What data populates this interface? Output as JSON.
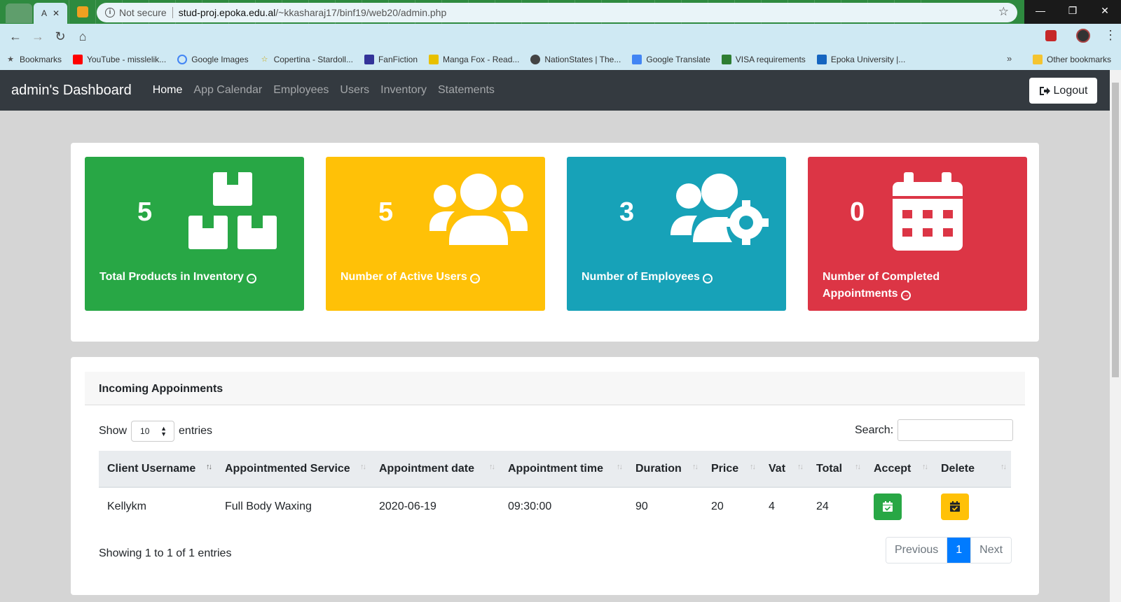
{
  "browser": {
    "active_tab_label": "A",
    "new_tab": "+",
    "window_controls": {
      "minimize": "—",
      "restore": "❐",
      "close": "✕"
    },
    "omnibox": {
      "security": "Not secure",
      "host": "stud-proj.epoka.edu.al",
      "path": "/~kkasharaj17/binf19/web20/admin.php"
    },
    "bookmarks": [
      {
        "label": "Bookmarks",
        "icon": "star-icon",
        "color": "#555555"
      },
      {
        "label": "YouTube - misslelik...",
        "icon": "youtube-icon",
        "color": "#ff0000"
      },
      {
        "label": "Google Images",
        "icon": "google-icon",
        "color": "#4285f4"
      },
      {
        "label": "Copertina - Stardoll...",
        "icon": "stardoll-icon",
        "color": "#f4c430"
      },
      {
        "label": "FanFiction",
        "icon": "fanfiction-icon",
        "color": "#333399"
      },
      {
        "label": "Manga Fox - Read...",
        "icon": "mangafox-icon",
        "color": "#e8c000"
      },
      {
        "label": "NationStates | The...",
        "icon": "nationstates-icon",
        "color": "#444444"
      },
      {
        "label": "Google Translate",
        "icon": "translate-icon",
        "color": "#4285f4"
      },
      {
        "label": "VISA requirements",
        "icon": "visa-icon",
        "color": "#2e7d32"
      },
      {
        "label": "Epoka University |...",
        "icon": "epoka-icon",
        "color": "#1565c0"
      }
    ],
    "bookmarks_more": "»",
    "other_bookmarks": "Other bookmarks"
  },
  "app": {
    "brand": "admin's Dashboard",
    "nav": [
      "Home",
      "App Calendar",
      "Employees",
      "Users",
      "Inventory",
      "Statements"
    ],
    "logout": "Logout"
  },
  "stats": [
    {
      "value": "5",
      "label": "Total Products in Inventory",
      "icon": "boxes-icon",
      "color": "#28a745"
    },
    {
      "value": "5",
      "label": "Number of Active Users",
      "icon": "users-icon",
      "color": "#ffc107"
    },
    {
      "value": "3",
      "label": "Number of Employees",
      "icon": "users-cog-icon",
      "color": "#17a2b8"
    },
    {
      "value": "0",
      "label": "Number of Completed Appointments",
      "icon": "calendar-icon",
      "color": "#dc3545"
    }
  ],
  "table": {
    "title": "Incoming Appoinments",
    "show_label": "Show",
    "entries_value": "10",
    "entries_label": "entries",
    "search_label": "Search:",
    "columns": [
      "Client Username",
      "Appointmented Service",
      "Appointment date",
      "Appointment time",
      "Duration",
      "Price",
      "Vat",
      "Total",
      "Accept",
      "Delete"
    ],
    "rows": [
      {
        "client": "Kellykm",
        "service": "Full Body Waxing",
        "date": "2020-06-19",
        "time": "09:30:00",
        "duration": "90",
        "price": "20",
        "vat": "4",
        "total": "24"
      }
    ],
    "accept_color": "#28a745",
    "delete_color": "#ffc107",
    "info": "Showing 1 to 1 of 1 entries",
    "pagination": {
      "previous": "Previous",
      "current": "1",
      "next": "Next"
    }
  }
}
